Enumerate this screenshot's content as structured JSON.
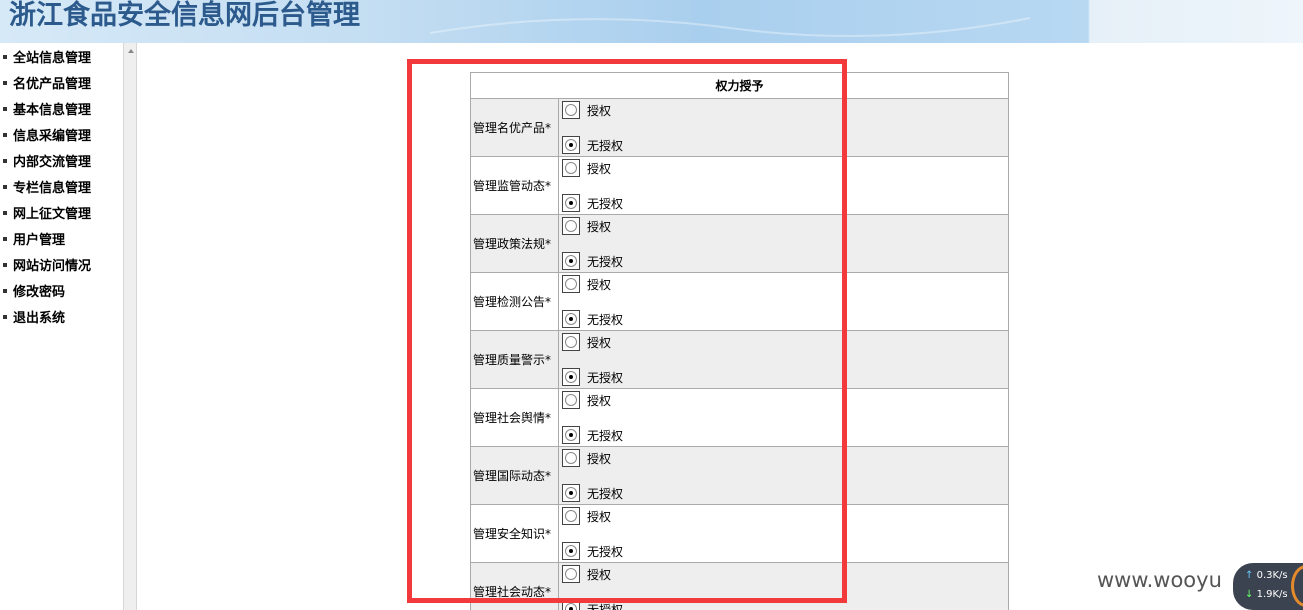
{
  "header": {
    "title": "浙江食品安全信息网后台管理"
  },
  "sidebar": {
    "items": [
      {
        "label": "全站信息管理"
      },
      {
        "label": "名优产品管理"
      },
      {
        "label": "基本信息管理"
      },
      {
        "label": "信息采编管理"
      },
      {
        "label": "内部交流管理"
      },
      {
        "label": "专栏信息管理"
      },
      {
        "label": "网上征文管理"
      },
      {
        "label": "用户管理"
      },
      {
        "label": "网站访问情况"
      },
      {
        "label": "修改密码"
      },
      {
        "label": "退出系统"
      }
    ]
  },
  "table": {
    "header": "权力授予",
    "grant_label": "授权",
    "deny_label": "无授权",
    "rows": [
      {
        "label": "管理名优产品*",
        "selected": "deny"
      },
      {
        "label": "管理监管动态*",
        "selected": "deny"
      },
      {
        "label": "管理政策法规*",
        "selected": "deny"
      },
      {
        "label": "管理检测公告*",
        "selected": "deny"
      },
      {
        "label": "管理质量警示*",
        "selected": "deny"
      },
      {
        "label": "管理社会舆情*",
        "selected": "deny"
      },
      {
        "label": "管理国际动态*",
        "selected": "deny"
      },
      {
        "label": "管理安全知识*",
        "selected": "deny"
      },
      {
        "label": "管理社会动态*",
        "selected": "deny"
      }
    ]
  },
  "colors": {
    "highlight_border": "#f2393b",
    "header_title": "#2c5a8c",
    "alt_row": "#eeeeee"
  },
  "watermark": "www.wooyu",
  "netmon": {
    "up": "0.3K/s",
    "down": "1.9K/s"
  }
}
